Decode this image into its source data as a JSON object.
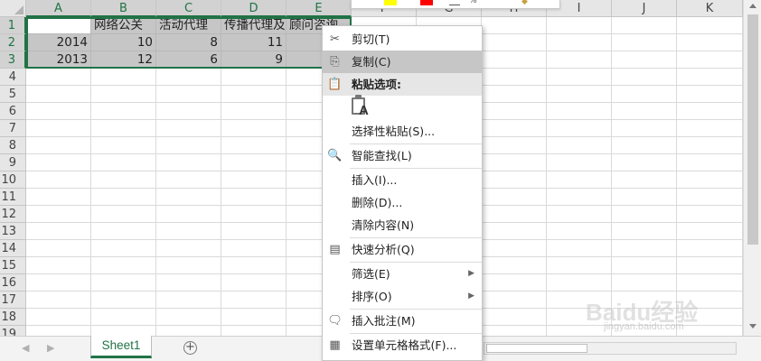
{
  "columns": [
    "A",
    "B",
    "C",
    "D",
    "E",
    "F",
    "G",
    "H",
    "I",
    "J",
    "K"
  ],
  "rows": [
    "1",
    "2",
    "3",
    "4",
    "5",
    "6",
    "7",
    "8",
    "9",
    "10",
    "11",
    "12",
    "13",
    "14",
    "15",
    "16",
    "17",
    "18",
    "19"
  ],
  "cells": {
    "B1": "网络公关",
    "C1": "活动代理",
    "D1": "传播代理及",
    "E1": "顾问咨询",
    "A2": "2014",
    "B2": "10",
    "C2": "8",
    "D2": "11",
    "A3": "2013",
    "B3": "12",
    "C3": "6",
    "D3": "9"
  },
  "sheet_tab": "Sheet1",
  "add_sheet_symbol": "+",
  "context_menu": [
    {
      "label": "剪切(T)",
      "icon": "✂"
    },
    {
      "label": "复制(C)",
      "icon": "⎘"
    },
    {
      "label": "粘贴选项:",
      "icon": "📋"
    },
    {
      "label": "选择性粘贴(S)..."
    },
    {
      "label": "智能查找(L)",
      "icon": "🔍"
    },
    {
      "label": "插入(I)..."
    },
    {
      "label": "删除(D)..."
    },
    {
      "label": "清除内容(N)"
    },
    {
      "label": "快速分析(Q)",
      "icon": "▤"
    },
    {
      "label": "筛选(E)",
      "submenu": "▶"
    },
    {
      "label": "排序(O)",
      "submenu": "▶"
    },
    {
      "label": "插入批注(M)",
      "icon": "🗨"
    },
    {
      "label": "设置单元格格式(F)...",
      "icon": "▦"
    }
  ],
  "paste_icon_letter": "A",
  "watermark": "Baidu经验",
  "watermark_sub": "jingyan.baidu.com",
  "colors": {
    "accent": "#217346",
    "selection": "#c6c6c6",
    "highlight": "#c6c6c6"
  }
}
